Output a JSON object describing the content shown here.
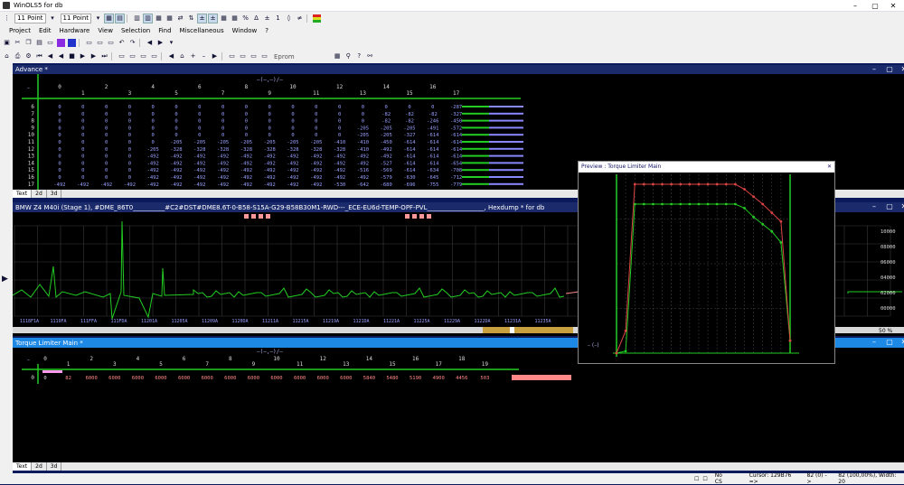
{
  "window": {
    "title": "WinOLS5 for db",
    "controls": [
      "–",
      "▢",
      "✕"
    ]
  },
  "toolbar1": {
    "font_label_a": "11 Point",
    "font_label_b": "11 Point"
  },
  "menu": [
    "Project",
    "Edit",
    "Hardware",
    "View",
    "Selection",
    "Find",
    "Miscellaneous",
    "Window",
    "?"
  ],
  "toolbar3": {
    "eprom_label": "Eprom"
  },
  "advance": {
    "title": "Advance *",
    "header_axis": "–(–,–)/–",
    "col_even": [
      "0",
      "2",
      "4",
      "6",
      "8",
      "10",
      "12",
      "14",
      "16"
    ],
    "col_odd": [
      "1",
      "3",
      "5",
      "7",
      "9",
      "11",
      "13",
      "15",
      "17"
    ],
    "rows": [
      {
        "idx": "6",
        "cells": [
          "0",
          "0",
          "0",
          "0",
          "0",
          "0",
          "0",
          "0",
          "0",
          "0",
          "0",
          "0",
          "0",
          "0",
          "0",
          "0",
          "0",
          "-287"
        ]
      },
      {
        "idx": "7",
        "cells": [
          "0",
          "0",
          "0",
          "0",
          "0",
          "0",
          "0",
          "0",
          "0",
          "0",
          "0",
          "0",
          "0",
          "0",
          "-82",
          "-82",
          "-82",
          "-327"
        ]
      },
      {
        "idx": "8",
        "cells": [
          "0",
          "0",
          "0",
          "0",
          "0",
          "0",
          "0",
          "0",
          "0",
          "0",
          "0",
          "0",
          "0",
          "0",
          "-82",
          "-82",
          "-246",
          "-450"
        ]
      },
      {
        "idx": "9",
        "cells": [
          "0",
          "0",
          "0",
          "0",
          "0",
          "0",
          "0",
          "0",
          "0",
          "0",
          "0",
          "0",
          "0",
          "-205",
          "-205",
          "-205",
          "-491",
          "-572"
        ]
      },
      {
        "idx": "10",
        "cells": [
          "0",
          "0",
          "0",
          "0",
          "0",
          "0",
          "0",
          "0",
          "0",
          "0",
          "0",
          "0",
          "0",
          "-205",
          "-205",
          "-327",
          "-614",
          "-614"
        ]
      },
      {
        "idx": "11",
        "cells": [
          "0",
          "0",
          "0",
          "0",
          "0",
          "-205",
          "-205",
          "-205",
          "-205",
          "-205",
          "-205",
          "-205",
          "-410",
          "-410",
          "-450",
          "-614",
          "-614",
          "-614"
        ]
      },
      {
        "idx": "12",
        "cells": [
          "0",
          "0",
          "0",
          "0",
          "-205",
          "-328",
          "-328",
          "-328",
          "-328",
          "-328",
          "-328",
          "-328",
          "-328",
          "-410",
          "-492",
          "-614",
          "-614",
          "-614"
        ]
      },
      {
        "idx": "13",
        "cells": [
          "0",
          "0",
          "0",
          "0",
          "-492",
          "-492",
          "-492",
          "-492",
          "-492",
          "-492",
          "-492",
          "-492",
          "-492",
          "-492",
          "-492",
          "-614",
          "-614",
          "-614"
        ]
      },
      {
        "idx": "14",
        "cells": [
          "0",
          "0",
          "0",
          "0",
          "-492",
          "-492",
          "-492",
          "-492",
          "-492",
          "-492",
          "-492",
          "-492",
          "-492",
          "-492",
          "-527",
          "-614",
          "-614",
          "-654"
        ]
      },
      {
        "idx": "15",
        "cells": [
          "0",
          "0",
          "0",
          "0",
          "-492",
          "-492",
          "-492",
          "-492",
          "-492",
          "-492",
          "-492",
          "-492",
          "-492",
          "-516",
          "-569",
          "-614",
          "-634",
          "-708"
        ]
      },
      {
        "idx": "16",
        "cells": [
          "0",
          "0",
          "0",
          "0",
          "-492",
          "-492",
          "-492",
          "-492",
          "-492",
          "-492",
          "-492",
          "-492",
          "-492",
          "-492",
          "-579",
          "-630",
          "-645",
          "-712",
          "-766"
        ]
      },
      {
        "idx": "17",
        "cells": [
          "-492",
          "-492",
          "-492",
          "-492",
          "-492",
          "-492",
          "-492",
          "-492",
          "-492",
          "-492",
          "-492",
          "-492",
          "-530",
          "-642",
          "-680",
          "-696",
          "-755",
          "-779"
        ]
      }
    ]
  },
  "tabs": {
    "text": "Text",
    "t2d": "2d",
    "t3d": "3d"
  },
  "hexdump": {
    "title": "BMW Z4 M40i (Stage 1), #DME_86T0__________#C2#DST#DME8.6T-0-B58-S15A-G29-B58B30M1-RWD---_ECE-EU6d-TEMP-OPF-PVL__________________, Hexdump * for db",
    "x_labels": [
      "1118F1A",
      "1119FA",
      "111FFA",
      "111FDA",
      "11201A",
      "11205A",
      "11209A",
      "1120DA",
      "11211A",
      "11215A",
      "11219A",
      "1121DA",
      "11221A",
      "11225A",
      "11229A",
      "1122DA",
      "11231A",
      "11235A"
    ],
    "y_labels": [
      "10000",
      "08000",
      "06000",
      "04000",
      "02000",
      "00000"
    ],
    "status_right": "50 %"
  },
  "preview": {
    "title": "Preview : Torque Limiter Main",
    "axis_label": "– (–)"
  },
  "torque": {
    "title": "Torque Limiter Main *",
    "header_axis": "–(–,–)/–",
    "col_even": [
      "0",
      "2",
      "4",
      "6",
      "8",
      "10",
      "12",
      "14",
      "16",
      "18"
    ],
    "col_odd": [
      "1",
      "3",
      "5",
      "7",
      "9",
      "11",
      "13",
      "15",
      "17",
      "19"
    ],
    "row_idx": "0",
    "row_values": [
      "0",
      "82",
      "6000",
      "6000",
      "6000",
      "6000",
      "6000",
      "6000",
      "6000",
      "6000",
      "6000",
      "6000",
      "6000",
      "6000",
      "5840",
      "5480",
      "5190",
      "4900",
      "4456",
      "503"
    ]
  },
  "status": {
    "cs": "No CS",
    "cursor": "Cursor: 129B76 =>",
    "value": "82 (0) ->",
    "width": "82 (100,00%), Width: 20"
  },
  "chart_data": {
    "type": "line",
    "title": "Torque Limiter Main",
    "series": [
      {
        "values": [
          0,
          82,
          6000,
          6000,
          6000,
          6000,
          6000,
          6000,
          6000,
          6000,
          6000,
          6000,
          6000,
          6000,
          5840,
          5480,
          5190,
          4900,
          4456,
          503
        ],
        "color": "#22cc22"
      },
      {
        "values": [
          0,
          900,
          6800,
          6800,
          6800,
          6800,
          6800,
          6800,
          6800,
          6800,
          6800,
          6800,
          6800,
          6800,
          6600,
          6300,
          6000,
          5650,
          5300,
          503
        ],
        "color": "#dd4444"
      }
    ],
    "grid": true
  }
}
